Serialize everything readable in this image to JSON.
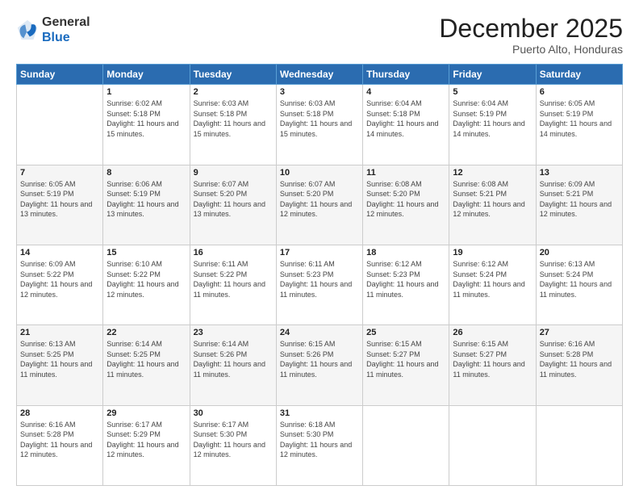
{
  "header": {
    "logo_general": "General",
    "logo_blue": "Blue",
    "month_title": "December 2025",
    "subtitle": "Puerto Alto, Honduras"
  },
  "weekdays": [
    "Sunday",
    "Monday",
    "Tuesday",
    "Wednesday",
    "Thursday",
    "Friday",
    "Saturday"
  ],
  "rows": [
    [
      {
        "day": "",
        "sunrise": "",
        "sunset": "",
        "daylight": ""
      },
      {
        "day": "1",
        "sunrise": "6:02 AM",
        "sunset": "5:18 PM",
        "daylight": "11 hours and 15 minutes."
      },
      {
        "day": "2",
        "sunrise": "6:03 AM",
        "sunset": "5:18 PM",
        "daylight": "11 hours and 15 minutes."
      },
      {
        "day": "3",
        "sunrise": "6:03 AM",
        "sunset": "5:18 PM",
        "daylight": "11 hours and 15 minutes."
      },
      {
        "day": "4",
        "sunrise": "6:04 AM",
        "sunset": "5:18 PM",
        "daylight": "11 hours and 14 minutes."
      },
      {
        "day": "5",
        "sunrise": "6:04 AM",
        "sunset": "5:19 PM",
        "daylight": "11 hours and 14 minutes."
      },
      {
        "day": "6",
        "sunrise": "6:05 AM",
        "sunset": "5:19 PM",
        "daylight": "11 hours and 14 minutes."
      }
    ],
    [
      {
        "day": "7",
        "sunrise": "6:05 AM",
        "sunset": "5:19 PM",
        "daylight": "11 hours and 13 minutes."
      },
      {
        "day": "8",
        "sunrise": "6:06 AM",
        "sunset": "5:19 PM",
        "daylight": "11 hours and 13 minutes."
      },
      {
        "day": "9",
        "sunrise": "6:07 AM",
        "sunset": "5:20 PM",
        "daylight": "11 hours and 13 minutes."
      },
      {
        "day": "10",
        "sunrise": "6:07 AM",
        "sunset": "5:20 PM",
        "daylight": "11 hours and 12 minutes."
      },
      {
        "day": "11",
        "sunrise": "6:08 AM",
        "sunset": "5:20 PM",
        "daylight": "11 hours and 12 minutes."
      },
      {
        "day": "12",
        "sunrise": "6:08 AM",
        "sunset": "5:21 PM",
        "daylight": "11 hours and 12 minutes."
      },
      {
        "day": "13",
        "sunrise": "6:09 AM",
        "sunset": "5:21 PM",
        "daylight": "11 hours and 12 minutes."
      }
    ],
    [
      {
        "day": "14",
        "sunrise": "6:09 AM",
        "sunset": "5:22 PM",
        "daylight": "11 hours and 12 minutes."
      },
      {
        "day": "15",
        "sunrise": "6:10 AM",
        "sunset": "5:22 PM",
        "daylight": "11 hours and 12 minutes."
      },
      {
        "day": "16",
        "sunrise": "6:11 AM",
        "sunset": "5:22 PM",
        "daylight": "11 hours and 11 minutes."
      },
      {
        "day": "17",
        "sunrise": "6:11 AM",
        "sunset": "5:23 PM",
        "daylight": "11 hours and 11 minutes."
      },
      {
        "day": "18",
        "sunrise": "6:12 AM",
        "sunset": "5:23 PM",
        "daylight": "11 hours and 11 minutes."
      },
      {
        "day": "19",
        "sunrise": "6:12 AM",
        "sunset": "5:24 PM",
        "daylight": "11 hours and 11 minutes."
      },
      {
        "day": "20",
        "sunrise": "6:13 AM",
        "sunset": "5:24 PM",
        "daylight": "11 hours and 11 minutes."
      }
    ],
    [
      {
        "day": "21",
        "sunrise": "6:13 AM",
        "sunset": "5:25 PM",
        "daylight": "11 hours and 11 minutes."
      },
      {
        "day": "22",
        "sunrise": "6:14 AM",
        "sunset": "5:25 PM",
        "daylight": "11 hours and 11 minutes."
      },
      {
        "day": "23",
        "sunrise": "6:14 AM",
        "sunset": "5:26 PM",
        "daylight": "11 hours and 11 minutes."
      },
      {
        "day": "24",
        "sunrise": "6:15 AM",
        "sunset": "5:26 PM",
        "daylight": "11 hours and 11 minutes."
      },
      {
        "day": "25",
        "sunrise": "6:15 AM",
        "sunset": "5:27 PM",
        "daylight": "11 hours and 11 minutes."
      },
      {
        "day": "26",
        "sunrise": "6:15 AM",
        "sunset": "5:27 PM",
        "daylight": "11 hours and 11 minutes."
      },
      {
        "day": "27",
        "sunrise": "6:16 AM",
        "sunset": "5:28 PM",
        "daylight": "11 hours and 11 minutes."
      }
    ],
    [
      {
        "day": "28",
        "sunrise": "6:16 AM",
        "sunset": "5:28 PM",
        "daylight": "11 hours and 12 minutes."
      },
      {
        "day": "29",
        "sunrise": "6:17 AM",
        "sunset": "5:29 PM",
        "daylight": "11 hours and 12 minutes."
      },
      {
        "day": "30",
        "sunrise": "6:17 AM",
        "sunset": "5:30 PM",
        "daylight": "11 hours and 12 minutes."
      },
      {
        "day": "31",
        "sunrise": "6:18 AM",
        "sunset": "5:30 PM",
        "daylight": "11 hours and 12 minutes."
      },
      {
        "day": "",
        "sunrise": "",
        "sunset": "",
        "daylight": ""
      },
      {
        "day": "",
        "sunrise": "",
        "sunset": "",
        "daylight": ""
      },
      {
        "day": "",
        "sunrise": "",
        "sunset": "",
        "daylight": ""
      }
    ]
  ],
  "row_shading": [
    false,
    true,
    false,
    true,
    false
  ]
}
